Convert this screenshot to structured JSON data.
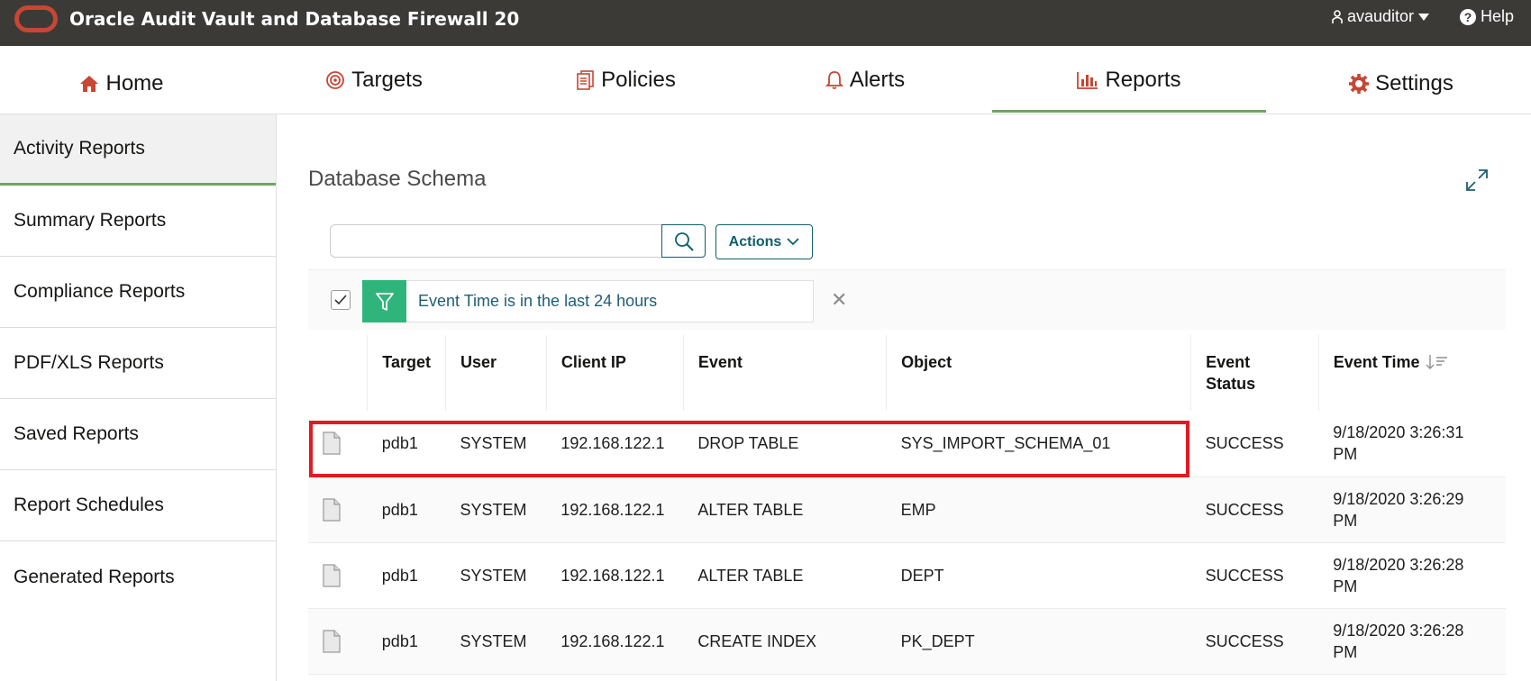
{
  "header": {
    "app_title": "Oracle Audit Vault and Database Firewall 20",
    "user": "avauditor",
    "help": "Help"
  },
  "nav": {
    "tabs": [
      {
        "label": "Home",
        "icon": "home-icon"
      },
      {
        "label": "Targets",
        "icon": "target-icon"
      },
      {
        "label": "Policies",
        "icon": "policy-document-icon"
      },
      {
        "label": "Alerts",
        "icon": "bell-icon"
      },
      {
        "label": "Reports",
        "icon": "bar-chart-icon",
        "active": true
      },
      {
        "label": "Settings",
        "icon": "gear-icon"
      }
    ]
  },
  "sidebar": {
    "items": [
      {
        "label": "Activity Reports",
        "active": true
      },
      {
        "label": "Summary Reports"
      },
      {
        "label": "Compliance Reports"
      },
      {
        "label": "PDF/XLS Reports"
      },
      {
        "label": "Saved Reports"
      },
      {
        "label": "Report Schedules"
      },
      {
        "label": "Generated Reports"
      }
    ]
  },
  "region": {
    "title": "Database Schema",
    "search_value": "",
    "actions_label": "Actions",
    "filter_text": "Event Time is in the last 24 hours"
  },
  "table": {
    "columns": [
      "",
      "Target",
      "User",
      "Client IP",
      "Event",
      "Object",
      "Event Status",
      "Event Time"
    ],
    "sorted_column": "Event Time",
    "rows": [
      {
        "target": "pdb1",
        "user": "SYSTEM",
        "client_ip": "192.168.122.1",
        "event": "DROP TABLE",
        "object": "SYS_IMPORT_SCHEMA_01",
        "status": "SUCCESS",
        "time": "9/18/2020 3:26:31 PM",
        "highlighted": true
      },
      {
        "target": "pdb1",
        "user": "SYSTEM",
        "client_ip": "192.168.122.1",
        "event": "ALTER TABLE",
        "object": "EMP",
        "status": "SUCCESS",
        "time": "9/18/2020 3:26:29 PM"
      },
      {
        "target": "pdb1",
        "user": "SYSTEM",
        "client_ip": "192.168.122.1",
        "event": "ALTER TABLE",
        "object": "DEPT",
        "status": "SUCCESS",
        "time": "9/18/2020 3:26:28 PM"
      },
      {
        "target": "pdb1",
        "user": "SYSTEM",
        "client_ip": "192.168.122.1",
        "event": "CREATE INDEX",
        "object": "PK_DEPT",
        "status": "SUCCESS",
        "time": "9/18/2020 3:26:28 PM"
      }
    ]
  },
  "colors": {
    "header_bg": "#3b3a37",
    "brand_red": "#c74634",
    "active_green": "#6da85d",
    "filter_green": "#2fb57c",
    "highlight_red": "#e21b23",
    "teal": "#0f5e6b"
  }
}
